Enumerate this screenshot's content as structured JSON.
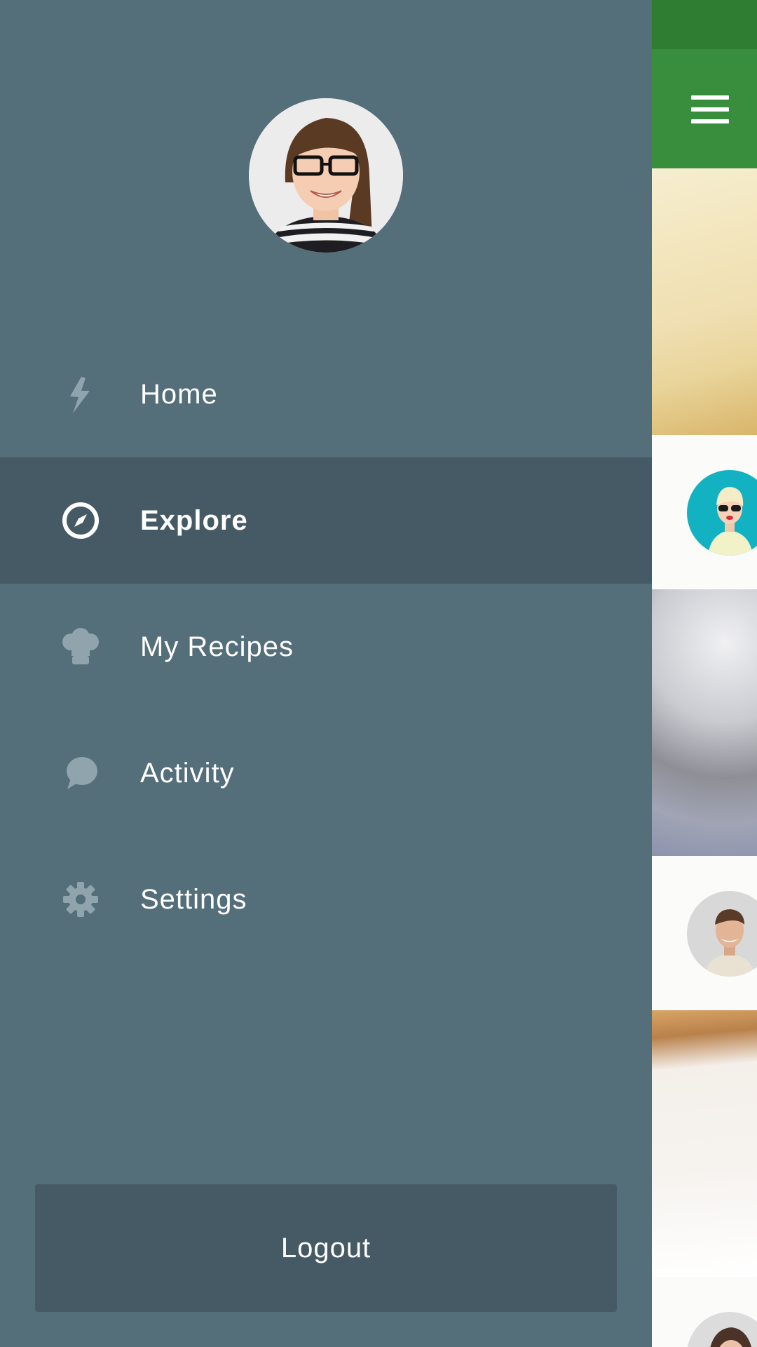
{
  "drawer": {
    "background_color": "#546e7a",
    "active_color": "#455a64",
    "profile": {
      "avatar": "user-avatar"
    },
    "items": [
      {
        "id": "home",
        "label": "Home",
        "icon": "bolt-icon",
        "active": false
      },
      {
        "id": "explore",
        "label": "Explore",
        "icon": "compass-icon",
        "active": true
      },
      {
        "id": "my-recipes",
        "label": "My Recipes",
        "icon": "chef-hat-icon",
        "active": false
      },
      {
        "id": "activity",
        "label": "Activity",
        "icon": "chat-bubble-icon",
        "active": false
      },
      {
        "id": "settings",
        "label": "Settings",
        "icon": "gear-icon",
        "active": false
      }
    ],
    "logout_label": "Logout"
  },
  "app_bar": {
    "status_color": "#2e7d32",
    "toolbar_color": "#388e3c",
    "menu_icon": "hamburger-menu-icon"
  },
  "feed_peek": {
    "photos": [
      "cheese-photo",
      "blurred-food-photo",
      "bread-photo"
    ],
    "authors": [
      "author-avatar-1",
      "author-avatar-2",
      "author-avatar-3"
    ]
  }
}
